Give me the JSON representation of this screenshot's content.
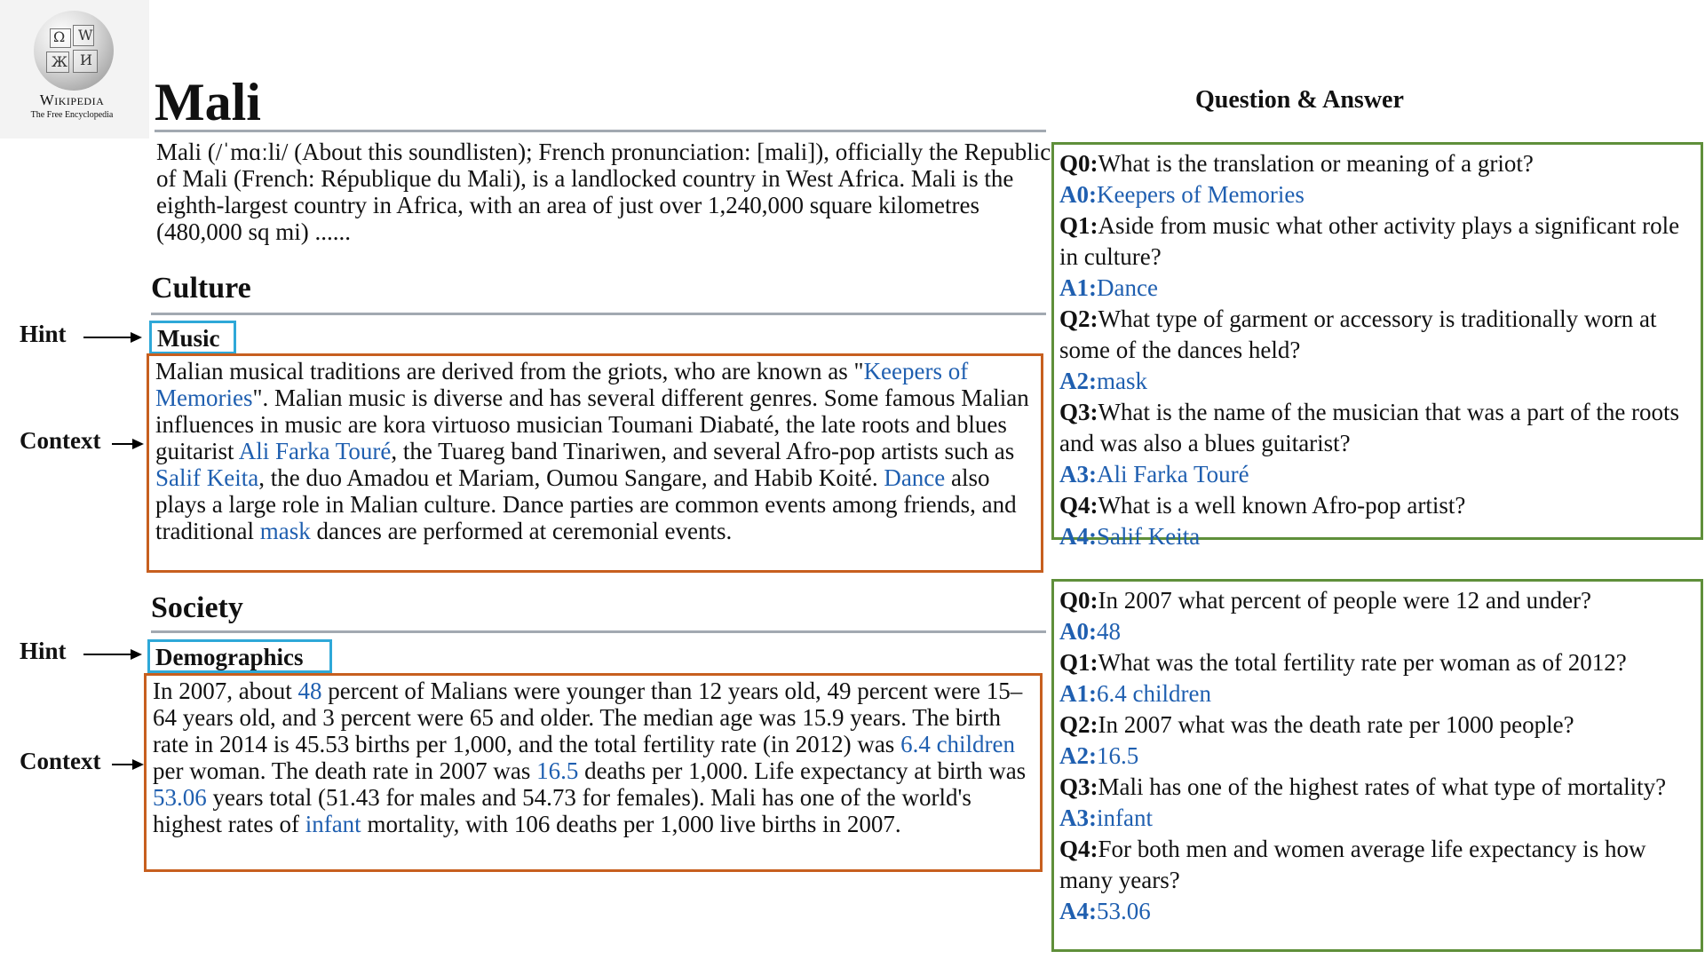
{
  "logo": {
    "wordmark": "Wikipedia",
    "tagline": "The Free Encyclopedia"
  },
  "article": {
    "title": "Mali",
    "intro": "Mali (/ˈmɑːli/ (About this soundlisten); French pronunciation: [mali]), officially the Republic of Mali (French: République du Mali), is a landlocked country in West Africa. Mali is the eighth-largest country in Africa, with an area of just over 1,240,000 square kilometres (480,000 sq mi) ......",
    "sections": [
      {
        "heading": "Culture",
        "hint": "Music",
        "context": [
          {
            "t": "Malian musical traditions are derived from the griots, who are known as \""
          },
          {
            "t": "Keepers of Memories",
            "link": true
          },
          {
            "t": "\". Malian music is diverse and has several different genres. Some famous Malian influences in music are kora virtuoso musician Toumani Diabaté, the late roots and blues guitarist "
          },
          {
            "t": "Ali Farka Touré",
            "link": true
          },
          {
            "t": ", the Tuareg band Tinariwen, and several Afro-pop artists such as "
          },
          {
            "t": "Salif Keita",
            "link": true
          },
          {
            "t": ", the duo Amadou et Mariam, Oumou Sangare, and Habib Koité. "
          },
          {
            "t": "Dance",
            "link": true
          },
          {
            "t": " also plays a large role in Malian culture. Dance parties are common events among friends, and traditional "
          },
          {
            "t": "mask",
            "link": true
          },
          {
            "t": " dances are performed at ceremonial events."
          }
        ]
      },
      {
        "heading": "Society",
        "hint": "Demographics",
        "context": [
          {
            "t": "In 2007, about "
          },
          {
            "t": "48",
            "link": true
          },
          {
            "t": " percent of Malians were younger than 12 years old, 49 percent were 15–64 years old, and 3 percent were 65 and older. The median age was 15.9 years. The birth rate in 2014 is 45.53 births per 1,000, and the total fertility rate (in 2012) was "
          },
          {
            "t": "6.4 children",
            "link": true
          },
          {
            "t": " per woman. The death rate in 2007 was "
          },
          {
            "t": "16.5",
            "link": true
          },
          {
            "t": " deaths per 1,000. Life expectancy at birth was "
          },
          {
            "t": "53.06",
            "link": true
          },
          {
            "t": " years total (51.43 for males and 54.73 for females). Mali has one of the world's highest rates of "
          },
          {
            "t": "infant",
            "link": true
          },
          {
            "t": " mortality, with 106 deaths per 1,000 live births in 2007."
          }
        ]
      }
    ]
  },
  "labels": {
    "hint": "Hint",
    "context": "Context"
  },
  "qa": {
    "heading": "Question & Answer",
    "groups": [
      [
        {
          "qid": "Q0:",
          "q": "What is the translation or meaning of a griot?",
          "aid": "A0:",
          "a": "Keepers of Memories"
        },
        {
          "qid": "Q1:",
          "q": "Aside from music what other activity plays a significant role in culture?",
          "aid": "A1:",
          "a": "Dance"
        },
        {
          "qid": "Q2:",
          "q": "What type of garment or accessory is traditionally worn at some of the dances held?",
          "aid": "A2:",
          "a": "mask"
        },
        {
          "qid": "Q3:",
          "q": "What is the name of the musician that was a part of the roots and was also a blues guitarist?",
          "aid": "A3:",
          "a": "Ali Farka Touré"
        },
        {
          "qid": "Q4:",
          "q": "What is a well known Afro-pop artist?",
          "aid": "A4:",
          "a": "Salif Keita"
        }
      ],
      [
        {
          "qid": "Q0:",
          "q": "In 2007 what percent of people were 12 and under?",
          "aid": "A0:",
          "a": "48"
        },
        {
          "qid": "Q1:",
          "q": "What was the total fertility rate per woman as of 2012?",
          "aid": "A1:",
          "a": "6.4 children"
        },
        {
          "qid": "Q2:",
          "q": "In 2007 what was the death rate per 1000 people?",
          "aid": "A2:",
          "a": "16.5"
        },
        {
          "qid": "Q3:",
          "q": "Mali has one of the highest rates of what type of mortality?",
          "aid": "A3:",
          "a": "infant"
        },
        {
          "qid": "Q4:",
          "q": "For both men and women average life expectancy is how many years?",
          "aid": "A4:",
          "a": "53.06"
        }
      ]
    ]
  }
}
